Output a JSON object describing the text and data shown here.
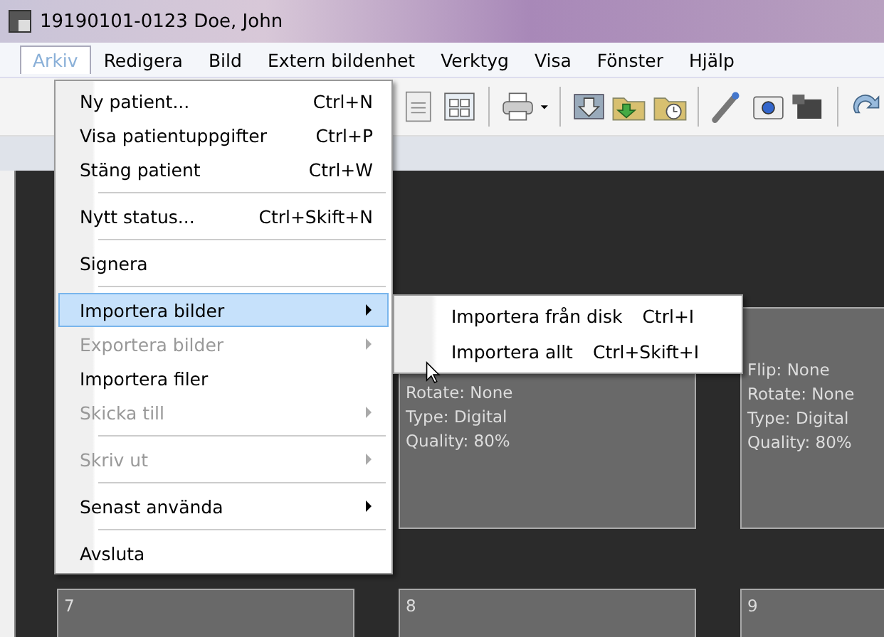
{
  "window": {
    "title": "19190101-0123 Doe, John"
  },
  "menubar": [
    {
      "label": "Arkiv",
      "selected": true
    },
    {
      "label": "Redigera",
      "selected": false
    },
    {
      "label": "Bild",
      "selected": false
    },
    {
      "label": "Extern bildenhet",
      "selected": false
    },
    {
      "label": "Verktyg",
      "selected": false
    },
    {
      "label": "Visa",
      "selected": false
    },
    {
      "label": "Fönster",
      "selected": false
    },
    {
      "label": "Hjälp",
      "selected": false
    }
  ],
  "menu": [
    {
      "kind": "item",
      "label": "Ny patient...",
      "shortcut": "Ctrl+N",
      "disabled": false,
      "submenu": false,
      "selected": false
    },
    {
      "kind": "item",
      "label": "Visa patientuppgifter",
      "shortcut": "Ctrl+P",
      "disabled": false,
      "submenu": false,
      "selected": false
    },
    {
      "kind": "item",
      "label": "Stäng patient",
      "shortcut": "Ctrl+W",
      "disabled": false,
      "submenu": false,
      "selected": false
    },
    {
      "kind": "separator"
    },
    {
      "kind": "item",
      "label": "Nytt status...",
      "shortcut": "Ctrl+Skift+N",
      "disabled": false,
      "submenu": false,
      "selected": false
    },
    {
      "kind": "separator"
    },
    {
      "kind": "item",
      "label": "Signera",
      "disabled": false,
      "submenu": false,
      "selected": false
    },
    {
      "kind": "separator"
    },
    {
      "kind": "item",
      "label": "Importera bilder",
      "disabled": false,
      "submenu": true,
      "selected": true
    },
    {
      "kind": "item",
      "label": "Exportera bilder",
      "disabled": true,
      "submenu": true,
      "selected": false
    },
    {
      "kind": "item",
      "label": "Importera filer",
      "disabled": false,
      "submenu": false,
      "selected": false
    },
    {
      "kind": "item",
      "label": "Skicka till",
      "disabled": true,
      "submenu": true,
      "selected": false
    },
    {
      "kind": "separator"
    },
    {
      "kind": "item",
      "label": "Skriv ut",
      "disabled": true,
      "submenu": true,
      "selected": false
    },
    {
      "kind": "separator"
    },
    {
      "kind": "item",
      "label": "Senast använda",
      "disabled": false,
      "submenu": true,
      "selected": false
    },
    {
      "kind": "separator"
    },
    {
      "kind": "item",
      "label": "Avsluta",
      "disabled": false,
      "submenu": false,
      "selected": false
    }
  ],
  "submenu": [
    {
      "label": "Importera från disk",
      "shortcut": "Ctrl+I"
    },
    {
      "label": "Importera allt",
      "shortcut": "Ctrl+Skift+I"
    }
  ],
  "tile_rows": [
    [
      {
        "lines": [
          "Rotate: None",
          "Type: Digital",
          "Quality: 80%"
        ]
      },
      {
        "lines": [
          "Flip: None",
          "Rotate: None",
          "Type: Digital",
          "Quality: 80%"
        ]
      }
    ],
    [
      {
        "number": "7"
      },
      {
        "number": "8"
      },
      {
        "number": "9"
      }
    ]
  ]
}
